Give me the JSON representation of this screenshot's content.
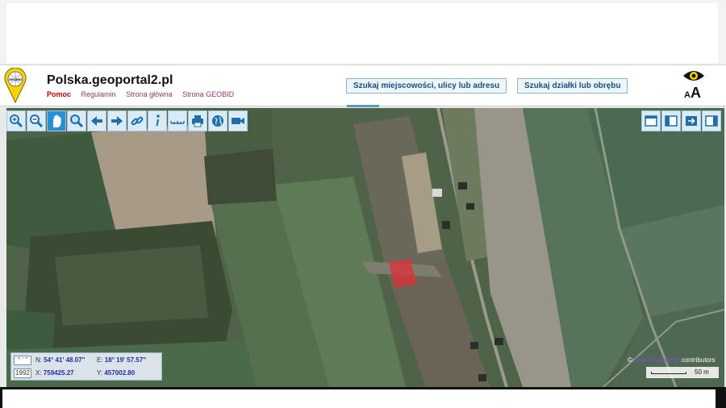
{
  "header": {
    "title": "Polska.geoportal2.pl",
    "logo_text": "GEOBID",
    "links": [
      "Pomoc",
      "Regulamin",
      "Strona główna",
      "Strona GEOBID"
    ],
    "search_place_label": "Szukaj miejscowości, ulicy lub adresu",
    "search_parcel_label": "Szukaj działki lub obrębu",
    "font_small": "A",
    "font_big": "A",
    "accent_color": "#5a9bbd"
  },
  "toolbar_left": [
    {
      "name": "zoom-in-icon"
    },
    {
      "name": "zoom-out-icon"
    },
    {
      "name": "pan-hand-icon",
      "active": true
    },
    {
      "name": "zoom-area-icon"
    },
    {
      "name": "arrow-left-icon"
    },
    {
      "name": "arrow-right-icon"
    },
    {
      "name": "link-icon"
    },
    {
      "name": "info-icon"
    },
    {
      "name": "measure-icon"
    },
    {
      "name": "print-icon"
    },
    {
      "name": "globe-icon"
    },
    {
      "name": "video-icon"
    }
  ],
  "toolbar_right": [
    {
      "name": "window-top-icon"
    },
    {
      "name": "window-left-icon"
    },
    {
      "name": "export-icon"
    },
    {
      "name": "window-right-icon"
    }
  ],
  "coords": {
    "crs_top": "° ' \"",
    "crs_bottom": "1992",
    "n_label": "N:",
    "n_value": "54° 41' 48.07\"",
    "e_label": "E:",
    "e_value": "18° 19' 57.57\"",
    "x_label": "X:",
    "x_value": "759425.27",
    "y_label": "Y:",
    "y_value": "457002.80"
  },
  "attribution": {
    "copyright": "©",
    "osm": "OpenStreetMap",
    "contributors": "contributors"
  },
  "scale": {
    "label": "50 m"
  },
  "highlight_color": "#e0303a"
}
